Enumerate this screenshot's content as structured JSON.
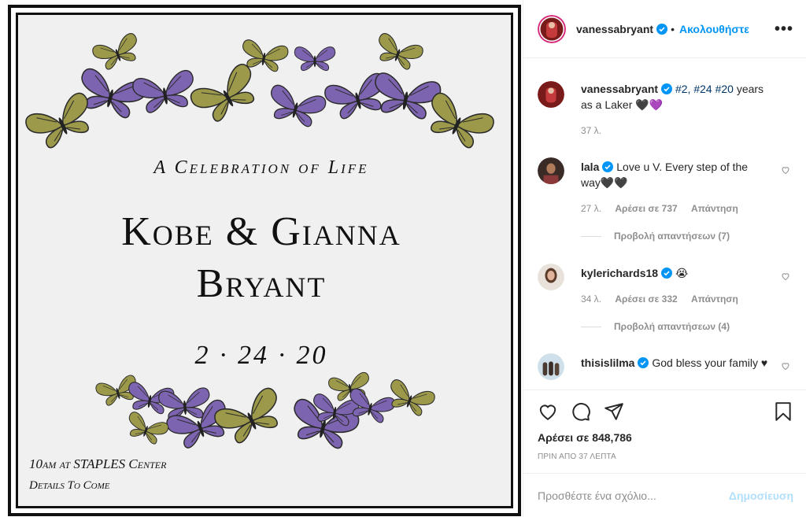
{
  "post_image": {
    "subtitle": "A Celebration of Life",
    "names_line1": "Kobe & Gianna",
    "names_line2": "Bryant",
    "date": "2 · 24 · 20",
    "time_place": "10am at STAPLES Center",
    "details": "Details To Come",
    "colors": {
      "purple_butterfly": "#7d64b0",
      "olive_butterfly": "#9c9a4a",
      "frame": "#111111",
      "paper": "#f1f0f1"
    }
  },
  "header": {
    "username": "vanessabryant",
    "separator": "•",
    "follow_label": "Ακολουθήστε",
    "more_label": "•••"
  },
  "caption": {
    "username": "vanessabryant",
    "tags": [
      "#2,",
      "#24",
      "#20"
    ],
    "text": "years as a Laker 🖤💜",
    "time": "37 λ."
  },
  "comments": [
    {
      "username": "lala",
      "text": "Love u V. Every step of the way🖤🖤",
      "time": "27 λ.",
      "likes": "Αρέσει σε 737",
      "reply": "Απάντηση",
      "view_replies": "Προβολή απαντήσεων (7)"
    },
    {
      "username": "kylerichards18",
      "text": "😭",
      "time": "34 λ.",
      "likes": "Αρέσει σε 332",
      "reply": "Απάντηση",
      "view_replies": "Προβολή απαντήσεων (4)"
    },
    {
      "username": "thisislilma",
      "text": "God bless your family ♥"
    }
  ],
  "actions": {
    "likes": "Αρέσει σε 848,786",
    "time_ago": "ΠΡΙΝ ΑΠΟ 37 ΛΕΠΤΑ",
    "icons": [
      "heart-icon",
      "comment-icon",
      "share-icon",
      "bookmark-icon"
    ]
  },
  "add_comment": {
    "placeholder": "Προσθέστε ένα σχόλιο...",
    "post_label": "Δημοσίευση"
  },
  "accent": "#0095f6"
}
